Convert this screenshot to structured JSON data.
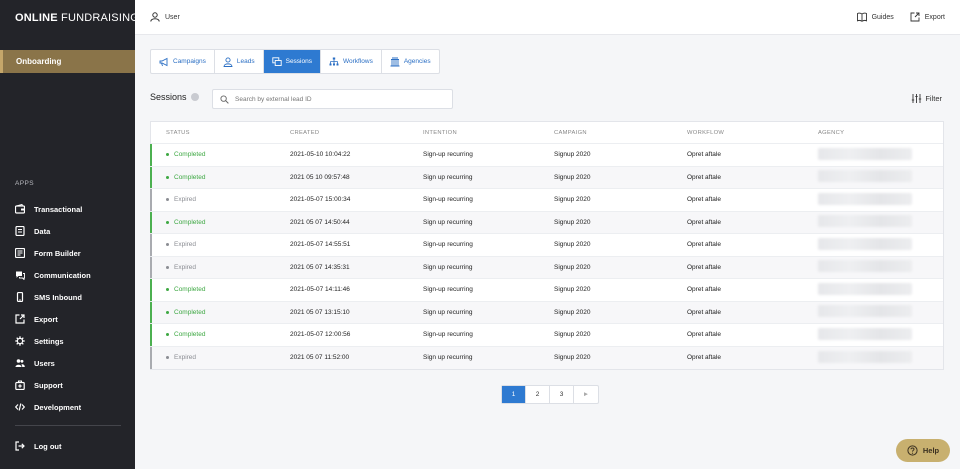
{
  "brand": {
    "bold": "ONLINE",
    "regular": " FUNDRAISING"
  },
  "sidebar": {
    "onboarding": "Onboarding",
    "apps_heading": "APPS",
    "items": [
      {
        "label": "Transactional",
        "icon": "wallet-icon"
      },
      {
        "label": "Data",
        "icon": "database-icon"
      },
      {
        "label": "Form Builder",
        "icon": "form-icon"
      },
      {
        "label": "Communication",
        "icon": "chat-icon"
      },
      {
        "label": "SMS Inbound",
        "icon": "phone-icon"
      },
      {
        "label": "Export",
        "icon": "export-icon"
      },
      {
        "label": "Settings",
        "icon": "gear-icon"
      },
      {
        "label": "Users",
        "icon": "users-icon"
      },
      {
        "label": "Support",
        "icon": "support-icon"
      },
      {
        "label": "Development",
        "icon": "code-icon"
      }
    ],
    "logout": "Log out"
  },
  "topbar": {
    "user": "User",
    "guides": "Guides",
    "export": "Export"
  },
  "tabs": [
    {
      "label": "Campaigns",
      "icon": "megaphone-icon",
      "active": false
    },
    {
      "label": "Leads",
      "icon": "person-icon",
      "active": false
    },
    {
      "label": "Sessions",
      "icon": "windows-icon",
      "active": true
    },
    {
      "label": "Workflows",
      "icon": "workflow-icon",
      "active": false
    },
    {
      "label": "Agencies",
      "icon": "building-icon",
      "active": false
    }
  ],
  "sessions": {
    "title": "Sessions",
    "search_placeholder": "Search by external lead ID",
    "filter_label": "Filter"
  },
  "table": {
    "headers": [
      "STATUS",
      "CREATED",
      "INTENTION",
      "CAMPAIGN",
      "WORKFLOW",
      "AGENCY"
    ],
    "rows": [
      {
        "status": "Completed",
        "created": "2021-05-10 10:04:22",
        "intention": "Sign-up recurring",
        "campaign": "Signup 2020",
        "workflow": "Opret aftale"
      },
      {
        "status": "Completed",
        "created": "2021 05 10 09:57:48",
        "intention": "Sign up recurring",
        "campaign": "Signup 2020",
        "workflow": "Opret aftale"
      },
      {
        "status": "Expired",
        "created": "2021-05-07 15:00:34",
        "intention": "Sign-up recurring",
        "campaign": "Signup 2020",
        "workflow": "Opret aftale"
      },
      {
        "status": "Completed",
        "created": "2021 05 07 14:50:44",
        "intention": "Sign up recurring",
        "campaign": "Signup 2020",
        "workflow": "Opret aftale"
      },
      {
        "status": "Expired",
        "created": "2021-05-07 14:55:51",
        "intention": "Sign-up recurring",
        "campaign": "Signup 2020",
        "workflow": "Opret aftale"
      },
      {
        "status": "Expired",
        "created": "2021 05 07 14:35:31",
        "intention": "Sign up recurring",
        "campaign": "Signup 2020",
        "workflow": "Opret aftale"
      },
      {
        "status": "Completed",
        "created": "2021-05-07 14:11:46",
        "intention": "Sign-up recurring",
        "campaign": "Signup 2020",
        "workflow": "Opret aftale"
      },
      {
        "status": "Completed",
        "created": "2021 05 07 13:15:10",
        "intention": "Sign up recurring",
        "campaign": "Signup 2020",
        "workflow": "Opret aftale"
      },
      {
        "status": "Completed",
        "created": "2021-05-07 12:00:56",
        "intention": "Sign-up recurring",
        "campaign": "Signup 2020",
        "workflow": "Opret aftale"
      },
      {
        "status": "Expired",
        "created": "2021 05 07 11:52:00",
        "intention": "Sign up recurring",
        "campaign": "Signup 2020",
        "workflow": "Opret aftale"
      }
    ]
  },
  "pagination": {
    "pages": [
      "1",
      "2",
      "3"
    ],
    "next": "►",
    "current": "1"
  },
  "help": {
    "label": "Help"
  },
  "colors": {
    "sidebar": "#232429",
    "accent_gold": "#8a7449",
    "primary_blue": "#2e7ad1",
    "completed": "#3ea843",
    "expired": "#8b8d93"
  }
}
